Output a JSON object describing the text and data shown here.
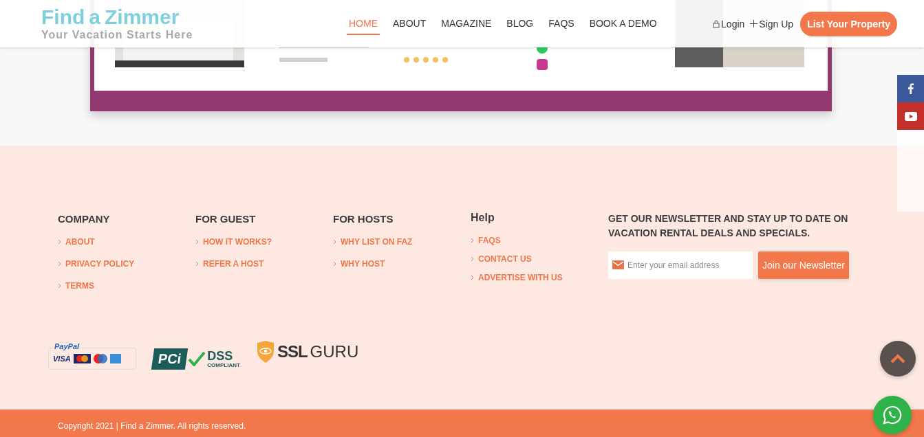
{
  "header": {
    "logo": {
      "word_1": "Find",
      "letter": "a",
      "word_2": "Zimmer",
      "tagline": "Your Vacation Starts Here"
    },
    "nav": [
      {
        "label": "HOME",
        "selected": true
      },
      {
        "label": "ABOUT",
        "selected": false
      },
      {
        "label": "MAGAZINE",
        "selected": false
      },
      {
        "label": "BLOG",
        "selected": false
      },
      {
        "label": "FAQS",
        "selected": false
      },
      {
        "label": "BOOK A DEMO",
        "selected": false
      }
    ],
    "login": "Login",
    "signup": "Sign Up",
    "cta": "List Your Property"
  },
  "footer": {
    "columns": [
      {
        "title": "COMPANY",
        "links": [
          "ABOUT",
          "PRIVACY POLICY",
          "TERMS"
        ]
      },
      {
        "title": "FOR GUEST",
        "links": [
          "HOW IT WORKS?",
          "REFER A HOST"
        ]
      },
      {
        "title": "FOR HOSTS",
        "links": [
          "WHY LIST ON FAZ",
          "WHY HOST"
        ]
      },
      {
        "title": "Help",
        "links": [
          "FAQS",
          "CONTACT US",
          "ADVERTISE WITH US"
        ]
      }
    ],
    "newsletter": {
      "heading": "GET OUR NEWSLETTER AND STAY UP TO DATE ON VACATION RENTAL DEALS AND SPECIALS.",
      "placeholder": "Enter your email address",
      "button": "Join our Newsletter"
    },
    "badges": [
      {
        "kind": "paypal",
        "texts": [
          "PayPal",
          "VISA"
        ]
      },
      {
        "kind": "pci",
        "texts": [
          "PCi",
          "DSS",
          "COMPLIANT"
        ]
      },
      {
        "kind": "ssl",
        "texts": [
          "SSL",
          "GURU"
        ]
      }
    ],
    "copyright": "Copyright 2021 | Find a Zimmer. All rights reserved."
  }
}
